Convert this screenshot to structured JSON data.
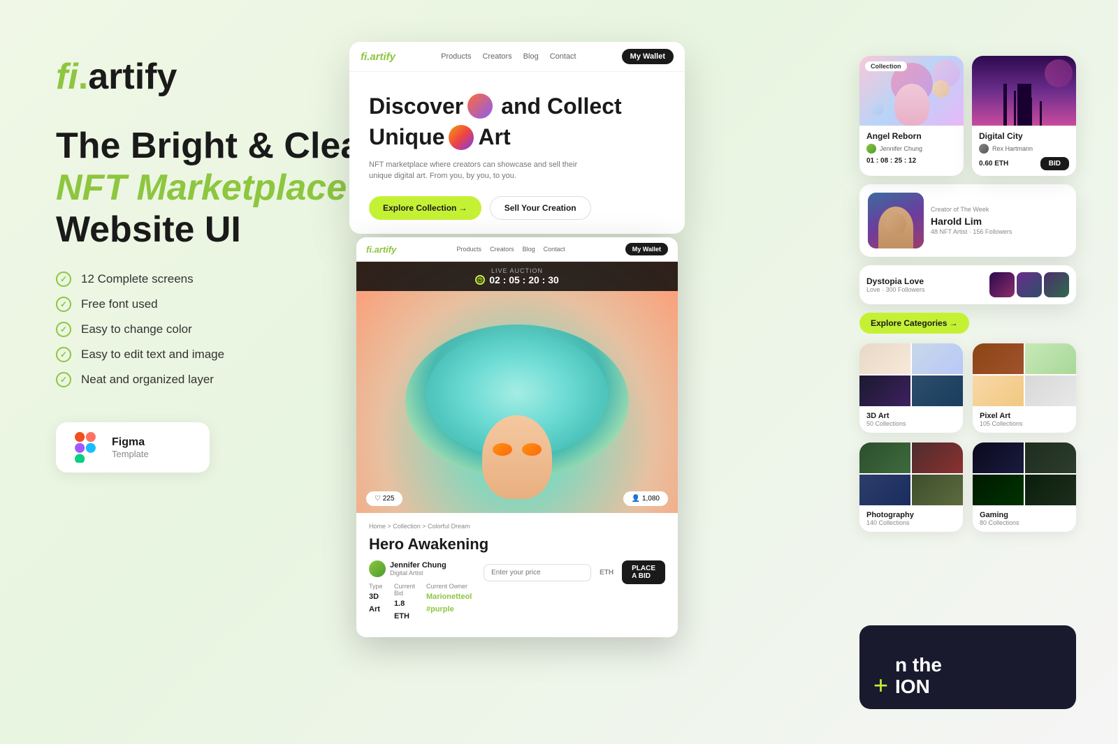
{
  "brand": {
    "logo_fi": "fi",
    "logo_dot": ".",
    "logo_artify": "artify"
  },
  "headline": {
    "line1": "The Bright & Clean",
    "line2": "NFT Marketplace +",
    "line3": "Website UI"
  },
  "features": [
    {
      "text": "12 Complete screens"
    },
    {
      "text": "Free font used"
    },
    {
      "text": "Easy to change color"
    },
    {
      "text": "Easy to edit text and image"
    },
    {
      "text": "Neat and organized layer"
    }
  ],
  "figma_badge": {
    "title": "Figma",
    "subtitle": "Template"
  },
  "browser_main": {
    "nav": {
      "logo_fi": "fi.",
      "logo_artify": "artify",
      "links": [
        "Products",
        "Creators",
        "Blog",
        "Contact"
      ],
      "wallet_btn": "My Wallet"
    },
    "hero": {
      "line1": "Discover",
      "line2": "and Collect",
      "line3": "Unique",
      "line4": "Art",
      "desc": "NFT marketplace where creators can showcase and sell their unique digital art. From you, by you, to you.",
      "btn_explore": "Explore Collection →",
      "btn_sell": "Sell Your Creation"
    }
  },
  "nft_cards": {
    "angel": {
      "name": "Angel Reborn",
      "author": "Jennifer Chung",
      "timer": "01 : 08 : 25 : 12",
      "collection_badge": "Collection"
    },
    "city": {
      "name": "Digital City",
      "author": "Rex Hartmann",
      "price": "0.60 ETH",
      "bid_btn": "BID"
    }
  },
  "creator_card": {
    "label": "Creator of The Week",
    "name": "Harold Lim",
    "stats": "48 NFT Artist · 156 Followers"
  },
  "dystopia_card": {
    "name": "Dystopia Love",
    "sub": "Love · 300 Followers"
  },
  "explore": {
    "btn": "Explore Categories →"
  },
  "categories": [
    {
      "name": "3D Art",
      "count": "50 Collections"
    },
    {
      "name": "Pixel Art",
      "count": "105 Collections"
    },
    {
      "name": "Photography",
      "count": "140 Collections"
    },
    {
      "name": "Gaming",
      "count": "80 Collections"
    }
  ],
  "auction": {
    "nav": {
      "logo_fi": "fi.",
      "logo_artify": "artify",
      "links": [
        "Products",
        "Creators",
        "Blog",
        "Contact"
      ],
      "wallet_btn": "My Wallet"
    },
    "banner_label": "LIVE AUCTION",
    "timer": "02 : 05 : 20 : 30",
    "likes": "♡ 225",
    "watchers": "👤 1,080"
  },
  "detail": {
    "breadcrumb": "Home > Collection > Colorful Dream",
    "title": "Hero Awakening",
    "author_name": "Jennifer Chung",
    "author_role": "Digital Artist",
    "type_label": "Type",
    "type_value": "3D Art",
    "bid_label": "Current Bid",
    "bid_value": "1.8 ETH",
    "owner_label": "Current Owner",
    "owner_value": "Marionetteol #purple",
    "input_placeholder": "Enter your price",
    "eth": "ETH",
    "place_bid_btn": "PLACE A BID"
  },
  "dark_section": {
    "plus": "+",
    "line1": "n the",
    "line2": "ION"
  }
}
